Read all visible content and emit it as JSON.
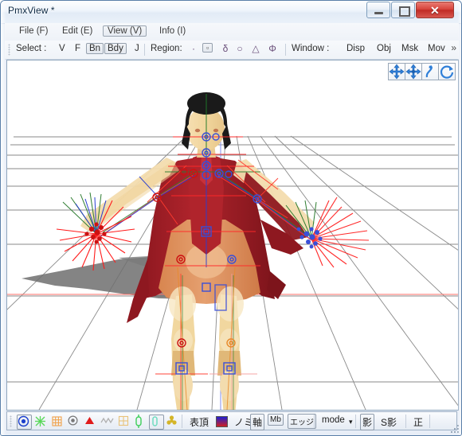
{
  "window": {
    "title": "PmxView *",
    "controls": {
      "minimize": "minimize-button",
      "maximize": "maximize-button",
      "close": "✕"
    }
  },
  "menu": {
    "items": [
      {
        "label": "File (F)",
        "active": false
      },
      {
        "label": "Edit (E)",
        "active": false
      },
      {
        "label": "View (V)",
        "active": true
      },
      {
        "label": "Info (I)",
        "active": false
      }
    ]
  },
  "toolbar": {
    "select_label": "Select :",
    "select_buttons": [
      {
        "label": "V",
        "pressed": false
      },
      {
        "label": "F",
        "pressed": false
      },
      {
        "label": "Bn",
        "pressed": true
      },
      {
        "label": "Bdy",
        "pressed": true
      },
      {
        "label": "J",
        "pressed": false
      }
    ],
    "region_label": "Region:",
    "region_glyphs": [
      {
        "glyph": "·",
        "name": "point-region-icon",
        "pressed": false
      },
      {
        "glyph": "▫",
        "name": "rect-region-icon",
        "pressed": true
      },
      {
        "glyph": "δ",
        "name": "freeform-region-icon",
        "pressed": false
      },
      {
        "glyph": "○",
        "name": "circle-region-icon",
        "pressed": false
      },
      {
        "glyph": "△",
        "name": "triangle-region-icon",
        "pressed": false
      },
      {
        "glyph": "Φ",
        "name": "sphere-region-icon",
        "pressed": false
      }
    ],
    "window_label": "Window :",
    "window_buttons": [
      "Disp",
      "Obj",
      "Msk",
      "Mov"
    ],
    "overflow": "»"
  },
  "viewport": {
    "gizmos": [
      {
        "name": "move-xy-gizmo",
        "title": "move-xy"
      },
      {
        "name": "move-all-gizmo",
        "title": "move-all"
      },
      {
        "name": "rotate-local-gizmo",
        "title": "rotate-local"
      },
      {
        "name": "rotate-view-gizmo",
        "title": "rotate-view"
      }
    ]
  },
  "bottombar": {
    "icons": [
      {
        "name": "vertex-display-icon",
        "glyph": "◉",
        "color": "#1b3fcc",
        "framed": true
      },
      {
        "name": "vertex-scatter-icon",
        "glyph": "※",
        "color": "#58d858",
        "framed": false
      },
      {
        "name": "weight-grid-icon",
        "glyph": "▩",
        "color": "#f0a24a",
        "framed": false
      },
      {
        "name": "bone-point-icon",
        "glyph": "◉",
        "color": "#777777",
        "framed": false
      },
      {
        "name": "face-triangle-icon",
        "glyph": "▲",
        "color": "#e01b1b",
        "framed": false
      },
      {
        "name": "wireframe-icon",
        "glyph": "〰",
        "color": "#aaaaaa",
        "framed": false
      },
      {
        "name": "uv-grid-icon",
        "glyph": "▨",
        "color": "#e8c37a",
        "framed": false
      },
      {
        "name": "joint-icon",
        "glyph": "⬍",
        "color": "#3ecf5a",
        "framed": false
      },
      {
        "name": "rigidbody-icon",
        "glyph": "▯",
        "color": "#8fe9c8",
        "framed": true
      },
      {
        "name": "morph-icon",
        "glyph": "✿",
        "color": "#d4b528",
        "framed": false
      }
    ],
    "buttons": [
      {
        "name": "omote-chou-button",
        "label": "表頂",
        "boxed": false
      },
      {
        "name": "normal-button",
        "label": "ノミ",
        "boxed": false
      },
      {
        "name": "axis-button",
        "label": "軸",
        "boxed": true
      },
      {
        "name": "bone-name-button",
        "label": "Mb",
        "boxed": true
      },
      {
        "name": "edge-button",
        "label": "エッジ",
        "boxed": true
      },
      {
        "name": "mode-button",
        "label": "mode",
        "boxed": false
      },
      {
        "name": "shadow-button",
        "label": "影",
        "boxed": true
      },
      {
        "name": "self-shadow-button",
        "label": "S影",
        "boxed": false
      },
      {
        "name": "orthographic-button",
        "label": "正",
        "boxed": false
      }
    ],
    "color_swatch": "gradient-blue-red",
    "mode_caret": "▾"
  },
  "colors": {
    "accent": "#1b3fcc",
    "close_button": "#c02b25",
    "frame_border": "#5a7fa8",
    "viewport_bg": "#ffffff",
    "grid_line": "#808080",
    "axis_x": "#ff3b30",
    "axis_y": "#2f7d32",
    "axis_z": "#2a3fd0",
    "skin": "#f0d49a",
    "dress": "#b0242c",
    "body_orange": "#e0935f",
    "hair": "#1a1a1a",
    "bone_marker_selected": "#d01010",
    "bone_marker": "#3a4fd8",
    "shadow": "#6f6f6f"
  }
}
